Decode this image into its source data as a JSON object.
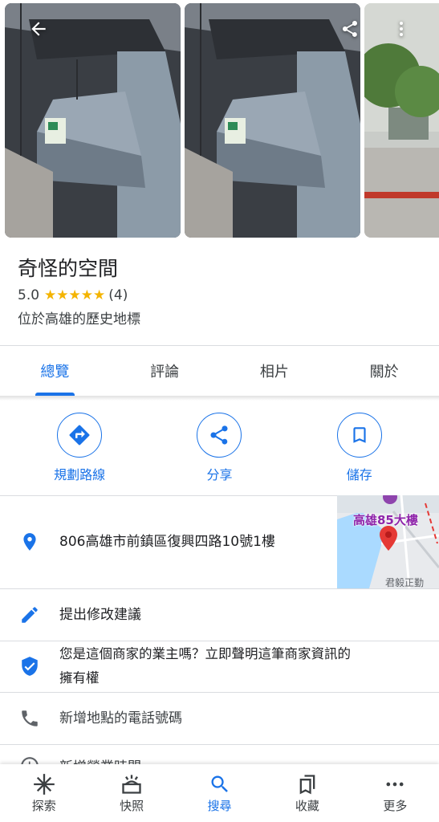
{
  "place": {
    "title": "奇怪的空間",
    "rating": "5.0",
    "stars": "★★★★★",
    "review_count": "(4)",
    "subtitle": "位於高雄的歷史地標"
  },
  "tabs": [
    {
      "label": "總覽",
      "active": true
    },
    {
      "label": "評論"
    },
    {
      "label": "相片"
    },
    {
      "label": "關於"
    }
  ],
  "actions": {
    "directions": "規劃路線",
    "share": "分享",
    "save": "儲存"
  },
  "info": {
    "address": "806高雄市前鎮區復興四路10號1樓",
    "suggest_edit": "提出修改建議",
    "claim_line1": "您是這個商家的業主嗎？立即聲明這筆商家資訊的",
    "claim_line2": "擁有權",
    "add_phone": "新增地點的電話號碼",
    "add_hours": "新增營業時間"
  },
  "map": {
    "landmark": "高雄85大樓",
    "street": "君毅正勤"
  },
  "bottom_nav": {
    "explore": "探索",
    "updates": "快照",
    "search": "搜尋",
    "saved": "收藏",
    "more": "更多"
  },
  "colors": {
    "accent": "#1a73e8",
    "star": "#f4b400",
    "pin": "#e53935"
  }
}
